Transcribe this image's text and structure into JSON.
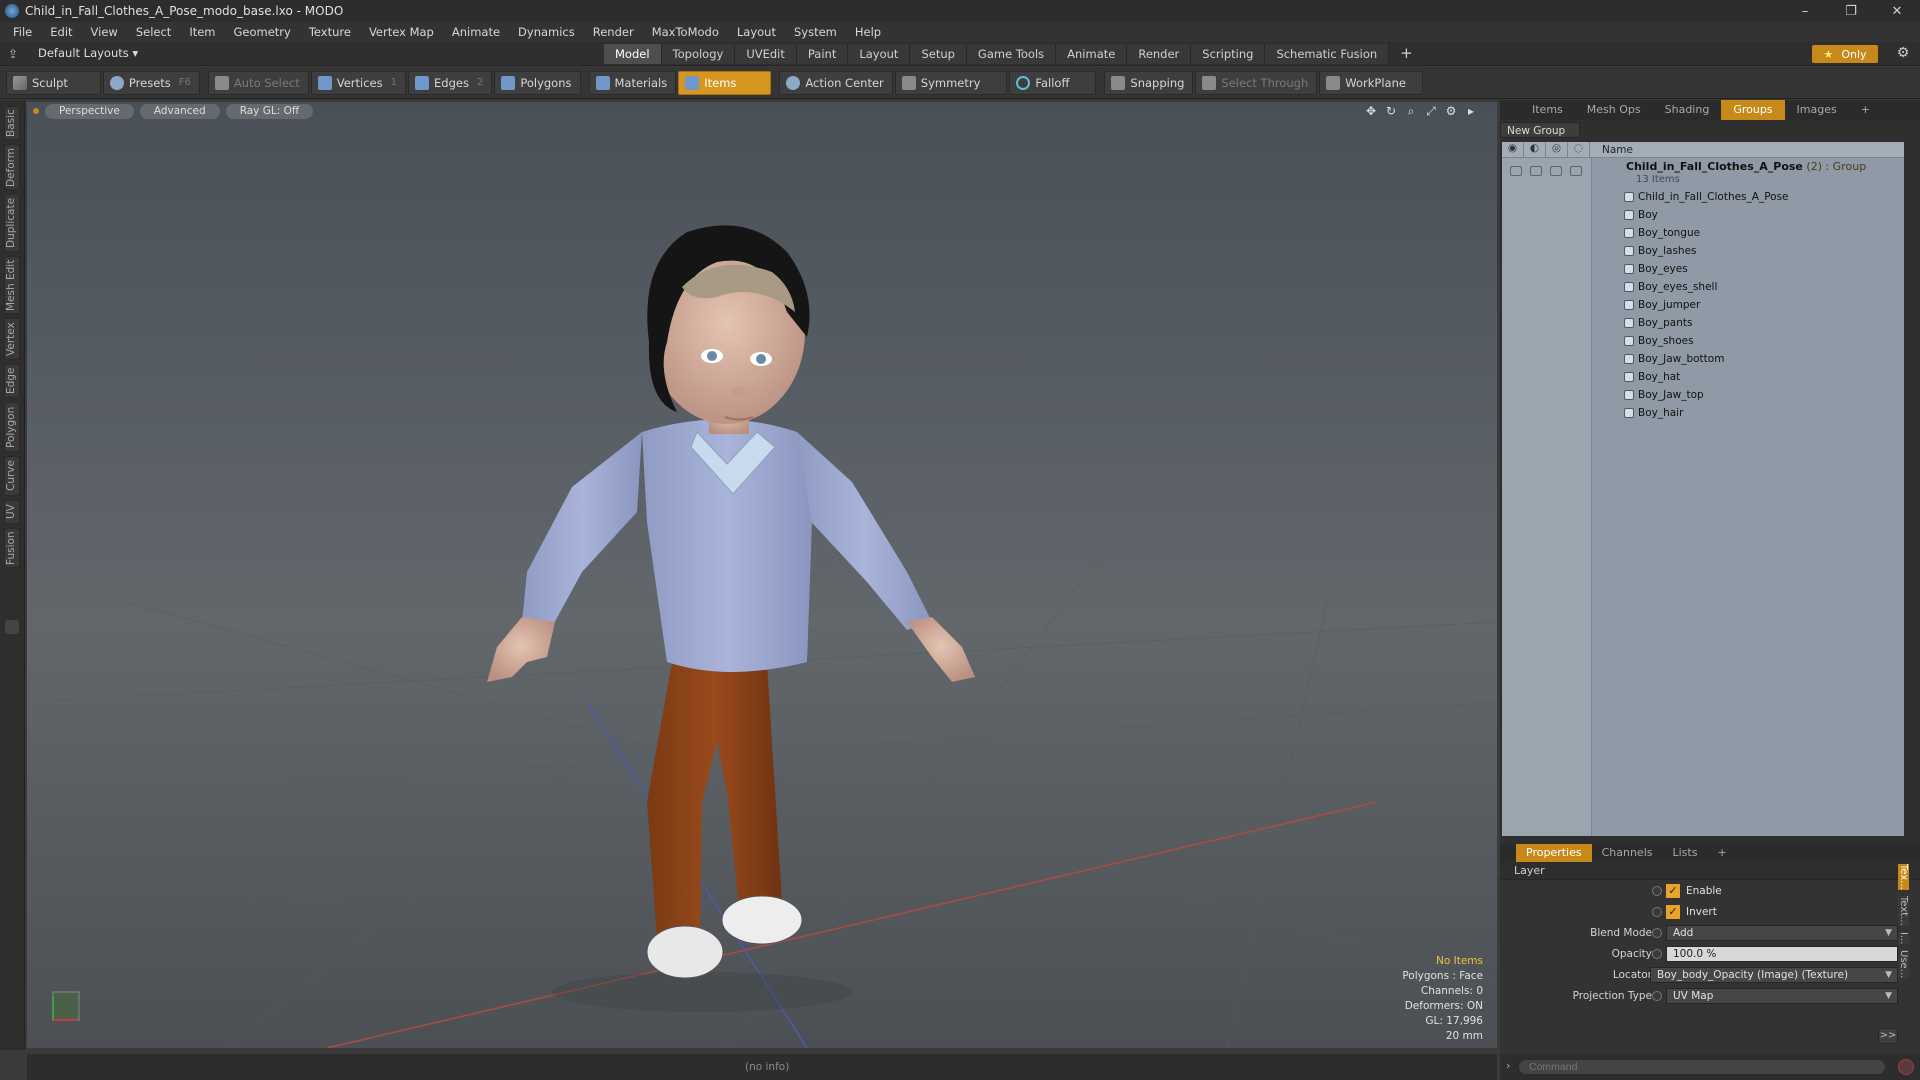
{
  "window": {
    "title": "Child_in_Fall_Clothes_A_Pose_modo_base.lxo - MODO",
    "minimize": "–",
    "restore": "❐",
    "close": "✕"
  },
  "menu": [
    "File",
    "Edit",
    "View",
    "Select",
    "Item",
    "Geometry",
    "Texture",
    "Vertex Map",
    "Animate",
    "Dynamics",
    "Render",
    "MaxToModo",
    "Layout",
    "System",
    "Help"
  ],
  "layoutbar": {
    "layout_label": "Default Layouts ▾",
    "tabs": [
      "Model",
      "Topology",
      "UVEdit",
      "Paint",
      "Layout",
      "Setup",
      "Game Tools",
      "Animate",
      "Render",
      "Scripting",
      "Schematic Fusion"
    ],
    "active_tab": "Model",
    "add": "+",
    "only_label": "Only"
  },
  "toolbar": {
    "sculpt": "Sculpt",
    "presets": "Presets",
    "presets_key": "F6",
    "auto_select": "Auto Select",
    "vertices": "Vertices",
    "vertices_count": "1",
    "edges": "Edges",
    "edges_count": "2",
    "polygons": "Polygons",
    "materials": "Materials",
    "items": "Items",
    "action_center": "Action Center",
    "symmetry": "Symmetry",
    "falloff": "Falloff",
    "snapping": "Snapping",
    "select_through": "Select Through",
    "workplane": "WorkPlane"
  },
  "left_tabs": [
    "Basic",
    "Deform",
    "Duplicate",
    "Mesh Edit",
    "Vertex",
    "Edge",
    "Polygon",
    "Curve",
    "UV",
    "Fusion"
  ],
  "viewport": {
    "view_mode": "Perspective",
    "shading": "Advanced",
    "raygl": "Ray GL: Off",
    "info": {
      "items": "No Items",
      "polygons": "Polygons : Face",
      "channels": "Channels: 0",
      "deformers": "Deformers: ON",
      "gl": "GL: 17,996",
      "scale": "20 mm"
    }
  },
  "status": "(no info)",
  "groups_panel": {
    "tabs": [
      "Items",
      "Mesh Ops",
      "Shading",
      "Groups",
      "Images"
    ],
    "active_tab": "Groups",
    "add": "+",
    "new_group": "New Group",
    "column_name": "Name",
    "group": {
      "name": "Child_in_Fall_Clothes_A_Pose",
      "count": " (2) : Group",
      "sub": "13 Items"
    },
    "items": [
      "Child_in_Fall_Clothes_A_Pose",
      "Boy",
      "Boy_tongue",
      "Boy_lashes",
      "Boy_eyes",
      "Boy_eyes_shell",
      "Boy_jumper",
      "Boy_pants",
      "Boy_shoes",
      "Boy_Jaw_bottom",
      "Boy_hat",
      "Boy_Jaw_top",
      "Boy_hair"
    ]
  },
  "properties_panel": {
    "tabs": [
      "Properties",
      "Channels",
      "Lists"
    ],
    "active_tab": "Properties",
    "add": "+",
    "section": "Layer",
    "enable": "Enable",
    "invert": "Invert",
    "blend_mode_label": "Blend Mode",
    "blend_mode": "Add",
    "opacity_label": "Opacity",
    "opacity": "100.0 %",
    "locator_label": "Locator",
    "locator": "Boy_body_Opacity (Image) (Texture)",
    "projection_label": "Projection Type",
    "projection": "UV Map",
    "side_tabs": [
      "Tex...",
      "Text...",
      "I...",
      "Use..."
    ],
    "more": ">>"
  },
  "command": {
    "placeholder": "Command"
  },
  "colors": {
    "accent": "#c78a1a",
    "panel": "#2f2f2f",
    "list_bg": "#8f9aa6"
  }
}
